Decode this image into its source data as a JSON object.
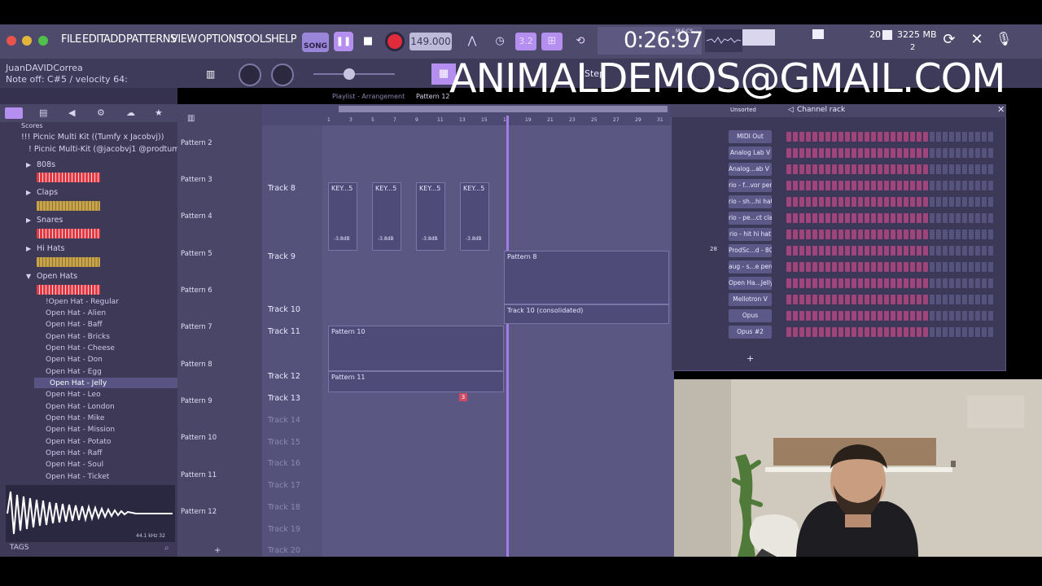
{
  "menu": [
    "FILE",
    "EDIT",
    "ADD",
    "PATTERNS",
    "VIEW",
    "OPTIONS",
    "TOOLS",
    "HELP"
  ],
  "transport": {
    "mode": "SONG",
    "tempo": "149.000",
    "time": "0:26:97",
    "time_units": "M:S:CS",
    "beat_display": "3.2"
  },
  "system": {
    "cpu": "20",
    "memory": "3225 MB",
    "polyphony": "2"
  },
  "hint": {
    "user": "JuanDAVIDCorrea",
    "text": "Note off: C#5 / velocity 64:"
  },
  "snap": "Step",
  "watermark": "ANIMALDEMOS@GMAIL.COM",
  "browser": {
    "folder_root": "Scores",
    "kit": "!!! Picnic Multi Kit ((Tumfy x Jacobvj))",
    "subkit": "! Picnic Multi-Kit (@jacobvj1 @prodtumfy)",
    "folders": [
      "808s",
      "Claps",
      "Snares",
      "Hi Hats",
      "Open Hats"
    ],
    "files": [
      "!Open Hat - Regular",
      "Open Hat - Alien",
      "Open Hat - Baff",
      "Open Hat - Bricks",
      "Open Hat - Cheese",
      "Open Hat - Don",
      "Open Hat - Egg",
      "Open Hat - Jelly",
      "Open Hat - Leo",
      "Open Hat - London",
      "Open Hat - Mike",
      "Open Hat - Mission",
      "Open Hat - Potato",
      "Open Hat - Raff",
      "Open Hat - Soul",
      "Open Hat - Ticket"
    ],
    "selected_file": "Open Hat - Jelly",
    "sample_info": "44.1 kHz 32",
    "tags_label": "TAGS"
  },
  "playlist": {
    "title": "Playlist - Arrangement",
    "pattern": "Pattern 12",
    "ruler": [
      "1",
      "3",
      "5",
      "7",
      "9",
      "11",
      "13",
      "15",
      "17",
      "19",
      "21",
      "23",
      "25",
      "27",
      "29",
      "31"
    ],
    "tracks": [
      "Track 8",
      "Track 9",
      "Track 10",
      "Track 11",
      "Track 12",
      "Track 13",
      "Track 14",
      "Track 15",
      "Track 16",
      "Track 17",
      "Track 18",
      "Track 19",
      "Track 20"
    ],
    "clips": {
      "key": "KEY...5",
      "db": "-3.8dB",
      "p8": "Pattern 8",
      "t10": "Track 10 (consolidated)",
      "p10": "Pattern 10",
      "p11": "Pattern 11",
      "p13": "3"
    }
  },
  "picker": [
    "Pattern 2",
    "Pattern 3",
    "Pattern 4",
    "Pattern 5",
    "Pattern 6",
    "Pattern 7",
    "Pattern 8",
    "Pattern 9",
    "Pattern 10",
    "Pattern 11",
    "Pattern 12"
  ],
  "channel_rack": {
    "title": "Channel rack",
    "filter": "Unsorted",
    "channels": [
      "MIDI Out",
      "Analog Lab V",
      "Analog...ab V #2",
      "rio - f...vor perc",
      "rio - sh...hi hat",
      "rio - pe...ct clap",
      "rio - hit hi hat",
      "ProdSc...d - 808",
      "aug - s...e perc",
      "Open Ha...Jelly",
      "Mellotron V",
      "Opus",
      "Opus #2"
    ],
    "mixer_number": "28"
  },
  "colors": {
    "accent": "#b58ff0",
    "rec": "#e02b3a",
    "swatch_red": "#e23a44",
    "swatch_gold": "#c9a34a",
    "step": "#a0447c"
  }
}
